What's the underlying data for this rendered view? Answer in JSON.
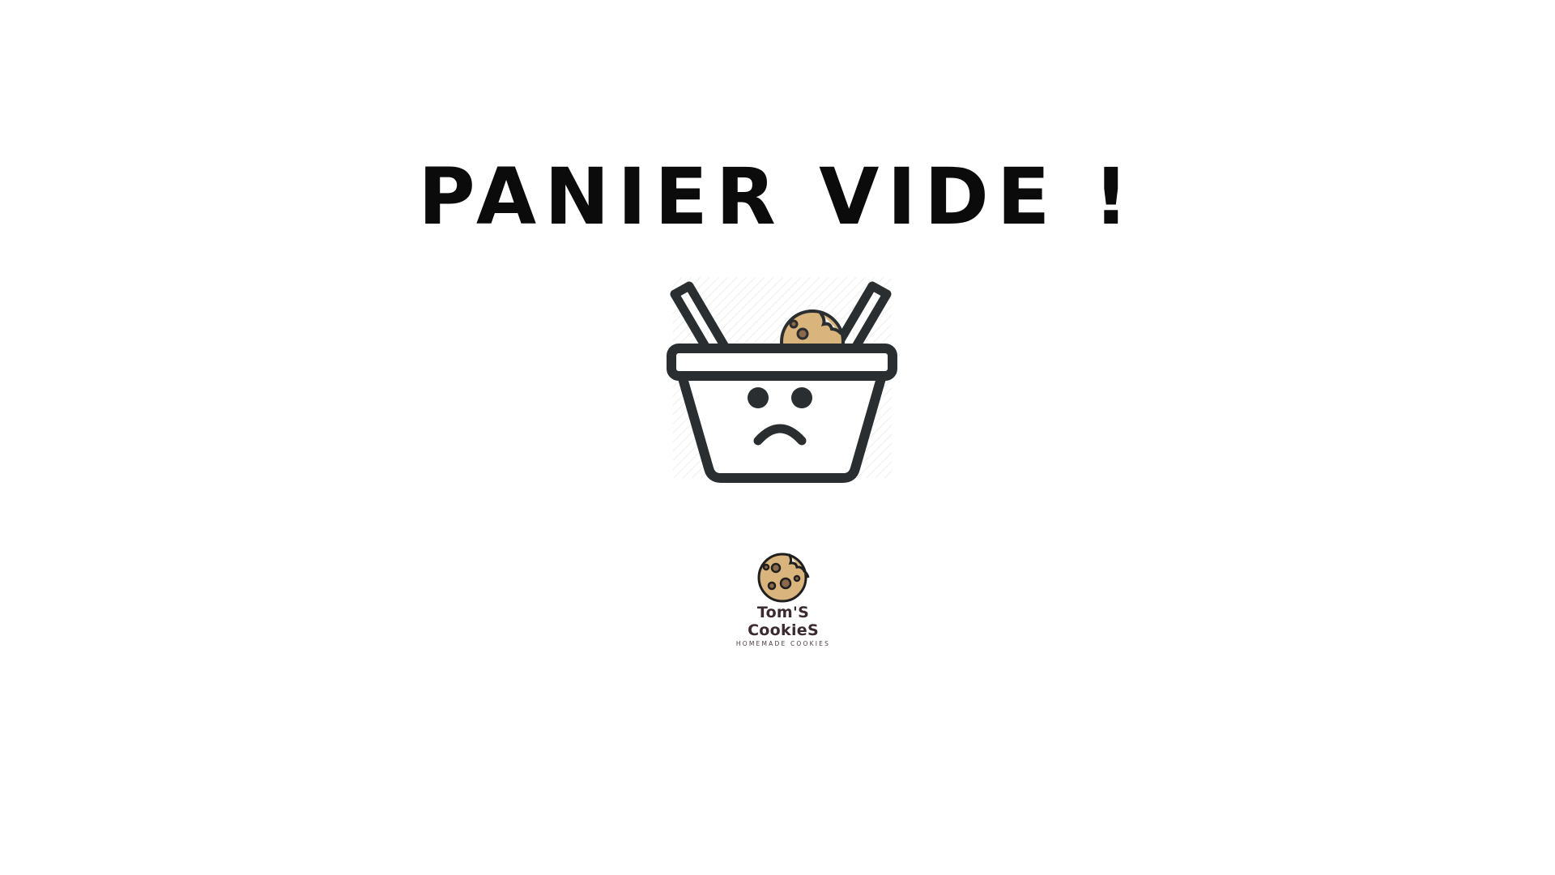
{
  "page": {
    "heading": "PANIER VIDE !"
  },
  "illustration": {
    "icon": "sad-basket-icon",
    "accent_cookie": "#d9b47c",
    "stroke": "#2b2e30"
  },
  "brand": {
    "icon": "cookie-logo-icon",
    "name": "Tom'S CookieS",
    "tagline": "HOMEMADE COOKIES",
    "text_color": "#3b2a2f"
  }
}
